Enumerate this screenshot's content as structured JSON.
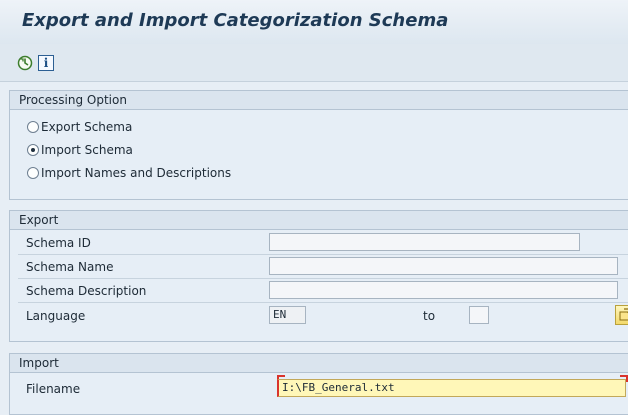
{
  "window": {
    "title": "Export and Import Categorization Schema"
  },
  "toolbar": {
    "execute_icon": "execute-clock-icon",
    "info_icon": "info-icon",
    "info_glyph": "i"
  },
  "processing": {
    "header": "Processing Option",
    "options": [
      {
        "label": "Export Schema",
        "selected": false
      },
      {
        "label": "Import Schema",
        "selected": true
      },
      {
        "label": "Import Names and Descriptions",
        "selected": false
      }
    ]
  },
  "export": {
    "header": "Export",
    "schema_id_label": "Schema ID",
    "schema_id_value": "",
    "schema_name_label": "Schema Name",
    "schema_name_value": "",
    "schema_desc_label": "Schema Description",
    "schema_desc_value": "",
    "language_label": "Language",
    "language_value": "EN",
    "to_label": "to",
    "to_value": "",
    "multi_select_icon": "multiple-selection-icon"
  },
  "import": {
    "header": "Import",
    "filename_label": "Filename",
    "filename_value": "I:\\FB_General.txt"
  },
  "colors": {
    "background": "#e7eef5",
    "title_text": "#1e3a56",
    "required_field": "#fff7b8",
    "required_marker": "#d9332c"
  }
}
